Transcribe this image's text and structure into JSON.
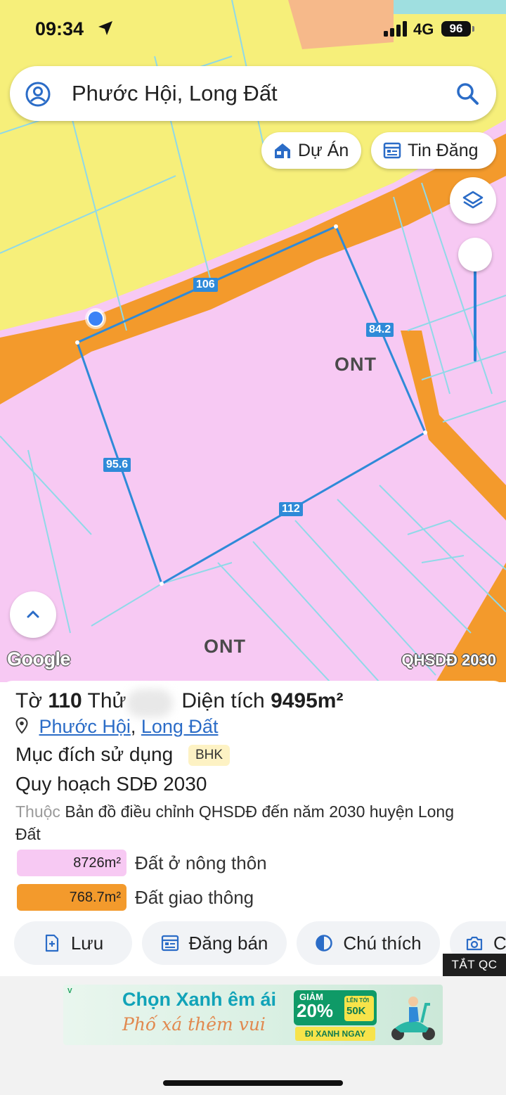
{
  "status_bar": {
    "time": "09:34",
    "network": "4G",
    "battery": "96"
  },
  "search": {
    "query": "Phước Hội, Long Đất"
  },
  "map_chips": [
    {
      "label": "Dự Án",
      "icon": "house-icon"
    },
    {
      "label": "Tin Đăng",
      "icon": "listing-icon"
    }
  ],
  "map": {
    "zone_labels": [
      "ONT",
      "ONT"
    ],
    "edge_lengths": [
      "106",
      "84.2",
      "95.6",
      "112"
    ],
    "google_label": "Google",
    "plan_tag": "QHSDĐ 2030",
    "colors": {
      "residential": "#f7c9f3",
      "road": "#f39a2c",
      "agri": "#f6ef7a",
      "boundary": "#2f8ad8"
    }
  },
  "parcel": {
    "sheet_prefix": "Tờ",
    "sheet_number": "110",
    "lot_prefix": "Thử",
    "area_prefix": "Diện tích",
    "area_value": "9495m²",
    "location_ward": "Phước Hội",
    "location_sep": ", ",
    "location_district": "Long Đất",
    "purpose_label": "Mục đích sử dụng",
    "purpose_code": "BHK",
    "plan_title": "Quy hoạch SDĐ 2030",
    "belong_prefix": "Thuộc",
    "belong_text": "Bản đồ điều chỉnh QHSDĐ đến năm 2030 huyện Long Đất",
    "areas": [
      {
        "value": "8726m²",
        "label": "Đất ở nông thôn",
        "color": "#f7c9f3"
      },
      {
        "value": "768.7m²",
        "label": "Đất giao thông",
        "color": "#f39a2c"
      }
    ]
  },
  "actions": {
    "save": "Lưu",
    "post_sale": "Đăng bán",
    "legend": "Chú thích",
    "camera": "C"
  },
  "ad": {
    "close_label": "TẮT QC",
    "brand": "V",
    "headline": "Chọn Xanh êm ái",
    "subline": "Phố xá thêm vui",
    "discount_label": "GIẢM",
    "discount": "20%",
    "upto_label": "LÊN TỚI",
    "upto_value": "50K",
    "cta": "ĐI XANH NGAY"
  }
}
